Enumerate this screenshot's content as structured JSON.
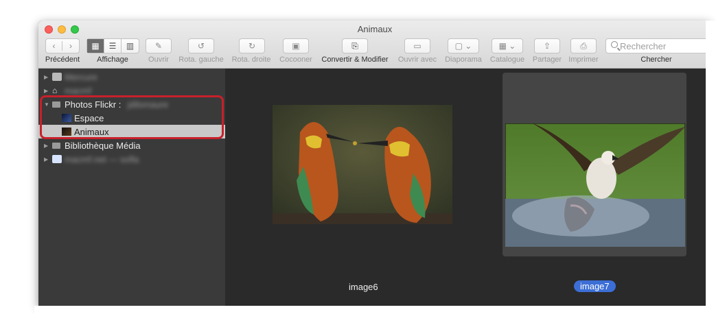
{
  "window": {
    "title": "Animaux"
  },
  "toolbar": {
    "back_label": "Précédent",
    "view_label": "Affichage",
    "open_label": "Ouvrir",
    "rotate_left_label": "Rota. gauche",
    "rotate_right_label": "Rota. droite",
    "cocoon_label": "Cocooner",
    "convert_label": "Convertir & Modifier",
    "open_with_label": "Ouvrir avec",
    "slideshow_label": "Diaporama",
    "catalog_label": "Catalogue",
    "share_label": "Partager",
    "print_label": "Imprimer",
    "search_label": "Chercher",
    "search_placeholder": "Rechercher"
  },
  "sidebar": {
    "items": [
      {
        "label": "Mercure",
        "blurred": true
      },
      {
        "label": "macmf",
        "blurred": true
      },
      {
        "label": "Photos Flickr :",
        "suffix": "jdilsmaure"
      },
      {
        "label": "Espace"
      },
      {
        "label": "Animaux",
        "selected": true
      },
      {
        "label": "Bibliothèque Média"
      },
      {
        "label": "macmf.net — sofla",
        "blurred": true
      }
    ]
  },
  "content": {
    "images": [
      {
        "caption": "image6",
        "selected": false
      },
      {
        "caption": "image7",
        "selected": true
      }
    ]
  },
  "colors": {
    "selection": "#3c6fd6",
    "highlight": "#c8202a"
  }
}
